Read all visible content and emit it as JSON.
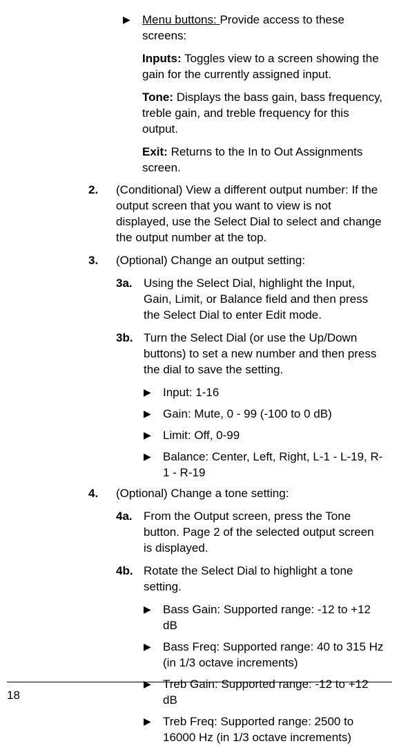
{
  "menuButtons": {
    "label": "Menu buttons: ",
    "intro": "Provide access to these screens:",
    "items": [
      {
        "name": "Inputs:",
        "desc": " Toggles view to a screen showing the gain for the currently assigned input."
      },
      {
        "name": "Tone:",
        "desc": " Displays the bass gain, bass frequency, treble gain, and treble frequency for this output."
      },
      {
        "name": "Exit:",
        "desc": " Returns to the In to Out Assignments screen."
      }
    ]
  },
  "steps": [
    {
      "num": "2.",
      "text": "(Conditional) View a different output number: If the output screen that you want to view is not displayed, use the Select Dial to select and change the output number at the top."
    },
    {
      "num": "3.",
      "text": "(Optional) Change an output setting:",
      "subs": [
        {
          "num": "3a.",
          "text": "Using the Select Dial, highlight the Input, Gain, Limit, or Balance field and then press the Select Dial to enter Edit mode."
        },
        {
          "num": "3b.",
          "text": "Turn the Select Dial (or use the Up/Down buttons) to set a new number and then press the dial to save the setting."
        }
      ],
      "bullets": [
        "Input: 1-16",
        "Gain: Mute, 0 - 99 (-100 to 0 dB)",
        "Limit: Off, 0-99",
        "Balance: Center, Left, Right, L-1 - L-19, R-1 - R-19"
      ]
    },
    {
      "num": "4.",
      "text": "(Optional) Change a tone setting:",
      "subs": [
        {
          "num": "4a.",
          "text": "From the Output screen, press the Tone button. Page 2 of the selected output screen is displayed."
        },
        {
          "num": "4b.",
          "text": "Rotate the Select Dial to highlight a tone setting."
        }
      ],
      "bullets": [
        "Bass Gain: Supported range: -12 to +12 dB",
        "Bass Freq: Supported range: 40 to 315 Hz (in 1/3 octave increments)",
        "Treb Gain: Supported range: -12 to +12 dB",
        "Treb Freq: Supported range: 2500 to 16000 Hz (in 1/3 octave increments)"
      ]
    }
  ],
  "pageNumber": "18"
}
